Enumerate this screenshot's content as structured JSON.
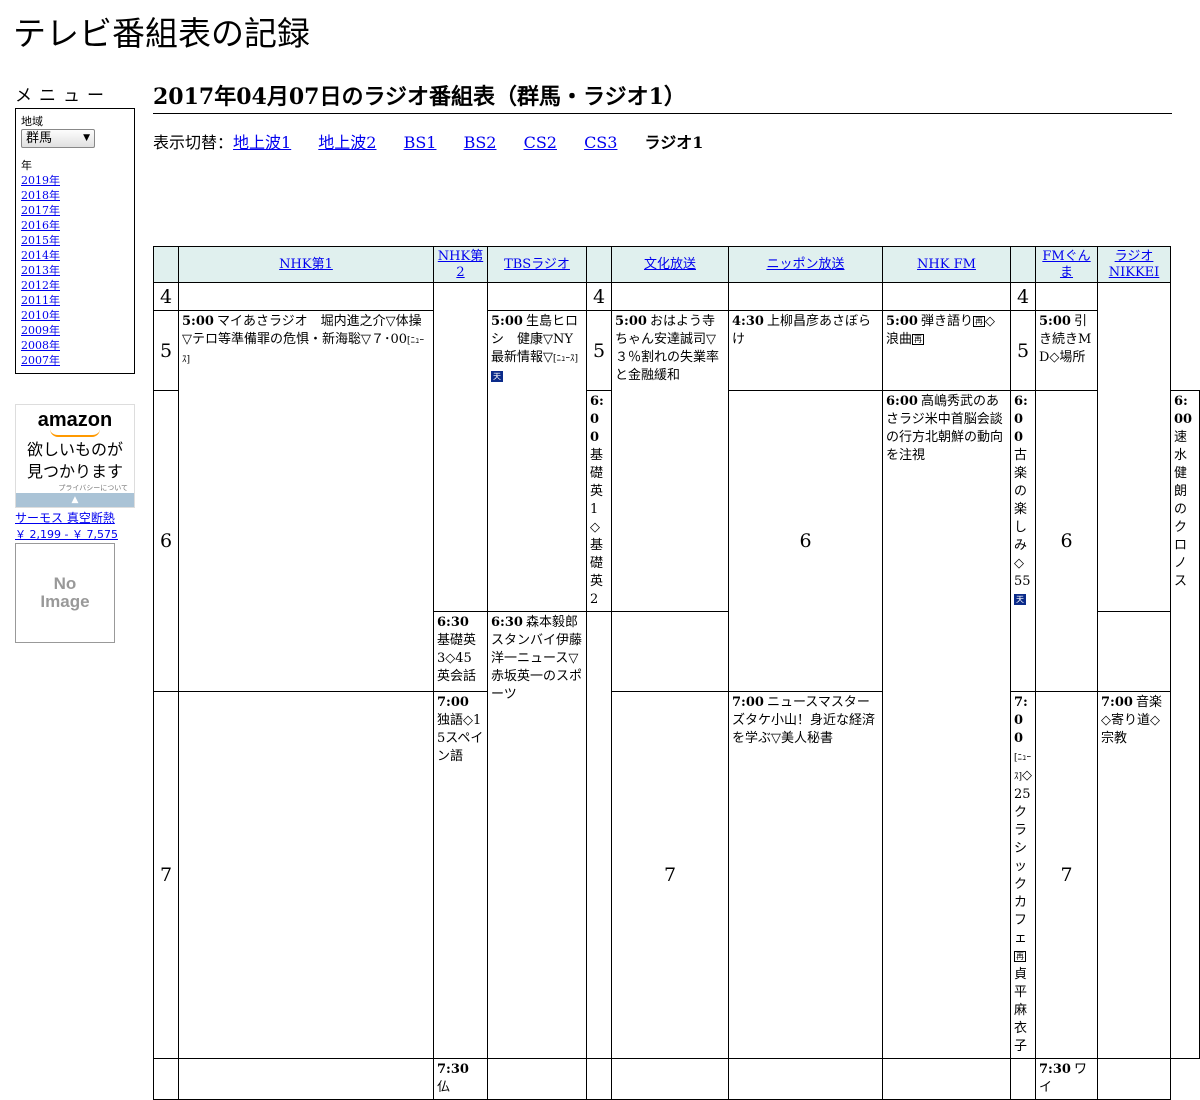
{
  "site": {
    "title": "テレビ番組表の記録"
  },
  "sidebar": {
    "menu_title": "メニュー",
    "region_label": "地域",
    "region_value": "群馬",
    "year_label": "年",
    "years": [
      "2019年",
      "2018年",
      "2017年",
      "2016年",
      "2015年",
      "2014年",
      "2013年",
      "2012年",
      "2011年",
      "2010年",
      "2009年",
      "2008年",
      "2007年"
    ],
    "ad": {
      "logo": "amazon",
      "tagline_1": "欲しいものが",
      "tagline_2": "見つかります",
      "privacy": "プライバシーについて",
      "product_name": "サーモス 真空断熱",
      "product_price": "￥ 2,199 - ￥ 7,575",
      "noimage_1": "No",
      "noimage_2": "Image"
    }
  },
  "main": {
    "heading": "2017年04月07日のラジオ番組表（群馬・ラジオ1）",
    "switch_label": "表示切替：",
    "switch_links": [
      "地上波1",
      "地上波2",
      "BS1",
      "BS2",
      "CS2",
      "CS3"
    ],
    "switch_current": "ラジオ1"
  },
  "schedule": {
    "stations": [
      "NHK第1",
      "NHK第2",
      "TBSラジオ",
      "文化放送",
      "ニッポン放送",
      "NHK FM",
      "FMぐんま",
      "ラジオNIKKEI"
    ],
    "hours": [
      "4",
      "5",
      "6",
      "7"
    ],
    "programs": {
      "nhk1_500_time": "5:00",
      "nhk1_500_text": "マイあさラジオ　堀内進之介▽体操▽テロ等準備罪の危惧・新海聡▽７･00",
      "nhk1_500_tag": "[ﾆｭｰｽ]",
      "tbs_500_time": "5:00",
      "tbs_500_text": "生島ヒロシ　健康▽NY最新情報▽",
      "tbs_500_tag": "[ﾆｭｰｽ]",
      "tbs_500_mark": "天",
      "bunka_500_time": "5:00",
      "bunka_500_text": "おはよう寺ちゃん安達誠司▽３％割れの失業率と金融緩和",
      "nippon_430_time": "4:30",
      "nippon_430_text": "上柳昌彦あさぼらけ",
      "fm_500_time": "5:00",
      "fm_500_text_1": "弾き語り",
      "fm_500_mark_1": "再",
      "fm_500_text_2": "◇浪曲",
      "fm_500_mark_2": "再",
      "gunma_500_time": "5:00",
      "gunma_500_text": "引き続きMD◇場所",
      "nhk2_600_time": "6:00",
      "nhk2_600_text": "基礎英1◇基礎英2",
      "nippon_600_time": "6:00",
      "nippon_600_text": "高嶋秀武のあさラジ米中首脳会談の行方北朝鮮の動向を注視",
      "fm_600_time": "6:00",
      "fm_600_text": "古楽の楽しみ◇55",
      "fm_600_mark": "天",
      "gunma_600_time": "6:00",
      "gunma_600_text": "速水健朗のクロノス",
      "nhk2_630_time": "6:30",
      "nhk2_630_text": "基礎英3◇45英会話",
      "tbs_630_time": "6:30",
      "tbs_630_text": "森本毅郎スタンバイ伊藤洋一ニュース▽赤坂英一のスポーツ",
      "nhk2_700_time": "7:00",
      "nhk2_700_text": "独語◇15スペイン語",
      "bunka_700_time": "7:00",
      "bunka_700_text": "ニュースマスターズタケ小山！身近な経済を学ぶ▽美人秘書",
      "fm_700_time": "7:00",
      "fm_700_tag": "[ﾆｭｰｽ]",
      "fm_700_text_1": "◇25クラシックカフェ",
      "fm_700_mark": "再",
      "fm_700_text_2": "貞平麻衣子",
      "nikkei_700_time": "7:00",
      "nikkei_700_text": "音楽◇寄り道◇宗教",
      "nhk2_730_time": "7:30",
      "nhk2_730_text": "仏",
      "gunma_730_time": "7:30",
      "gunma_730_text": "ワイ"
    }
  },
  "colors": {
    "header_bg": "#e0f0ee",
    "link": "#0000ee",
    "mark_bg": "#0b2b8a"
  }
}
